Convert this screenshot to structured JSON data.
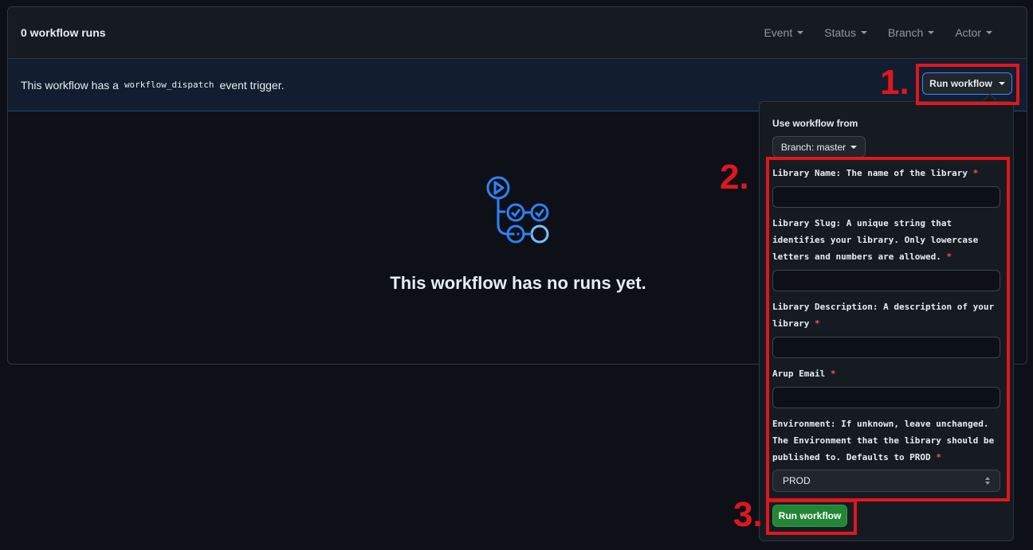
{
  "header": {
    "runs_count": "0 workflow runs",
    "filters": [
      "Event",
      "Status",
      "Branch",
      "Actor"
    ]
  },
  "dispatch": {
    "text_before": "This workflow has a",
    "code": "workflow_dispatch",
    "text_after": "event trigger.",
    "run_button_label": "Run workflow"
  },
  "empty_state": {
    "title": "This workflow has no runs yet.",
    "icon": "workflow-icon"
  },
  "panel": {
    "title": "Use workflow from",
    "branch_label": "Branch: master",
    "fields": [
      {
        "label": "Library Name: The name of the library",
        "required": "*",
        "value": ""
      },
      {
        "label": "Library Slug: A unique string that identifies your library. Only lowercase letters and numbers are allowed.",
        "required": "*",
        "value": ""
      },
      {
        "label": "Library Description: A description of your library",
        "required": "*",
        "value": ""
      },
      {
        "label": "Arup Email",
        "required": "*",
        "value": ""
      }
    ],
    "environment": {
      "label": "Environment: If unknown, leave unchanged. The Environment that the library should be published to. Defaults to PROD",
      "required": "*",
      "selected": "PROD"
    },
    "submit_label": "Run workflow"
  },
  "annotations": [
    "1.",
    "2.",
    "3."
  ],
  "colors": {
    "accent_red": "#e0161e",
    "submit_green": "#238636",
    "focus_blue": "#388bfd"
  }
}
